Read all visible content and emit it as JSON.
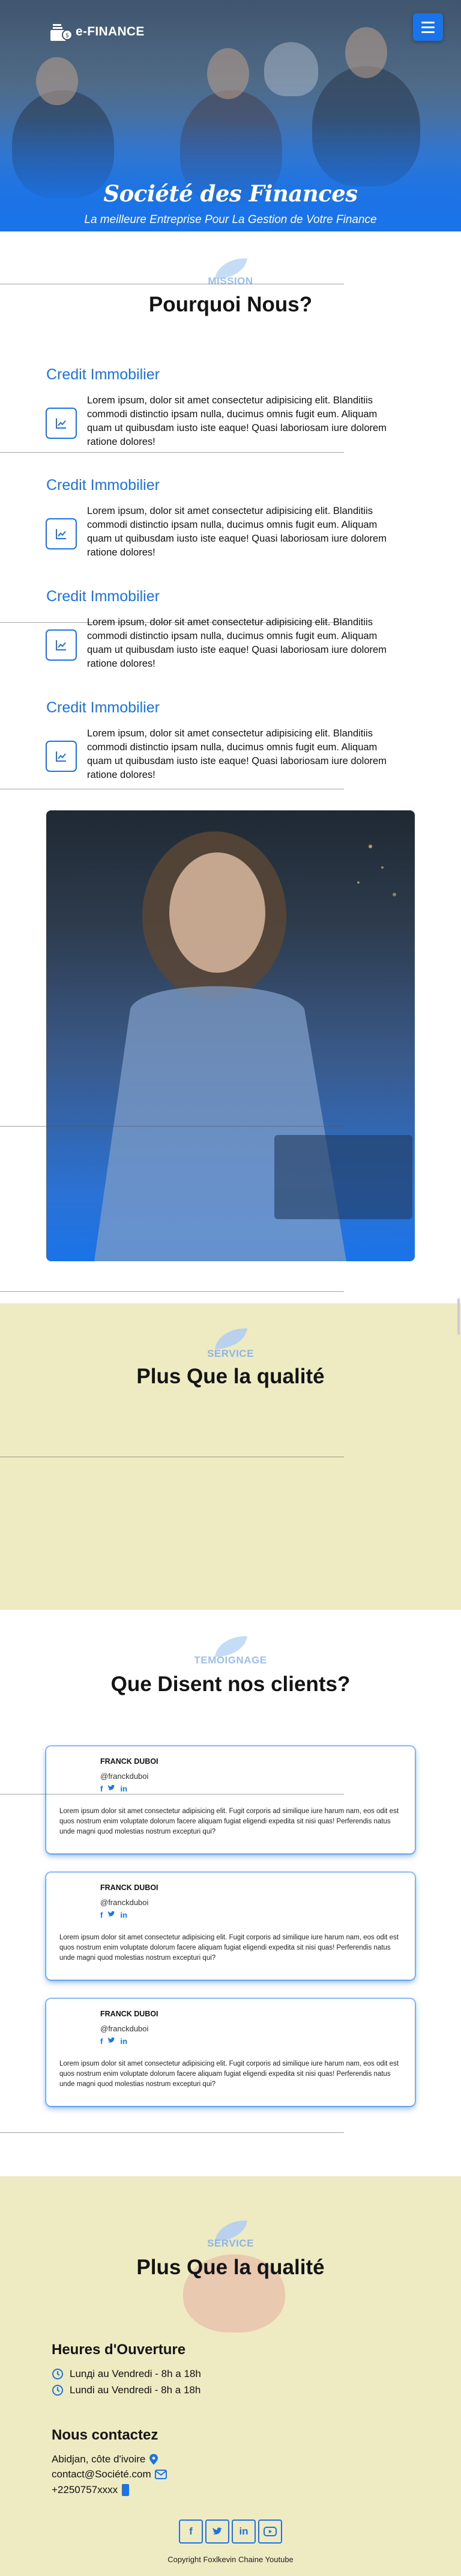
{
  "header": {
    "brand": "e-FINANCE",
    "title": "Société des Finances",
    "subtitle": "La meilleure Entreprise Pour La Gestion de Votre Finance",
    "menu_icon": "hamburger-menu-icon"
  },
  "mission": {
    "tag": "MISSION",
    "title": "Pourquoi Nous?",
    "items": [
      {
        "title": "Credit Immobilier",
        "text": "Lorem ipsum, dolor sit amet consectetur adipisicing elit. Blanditiis commodi distinctio ipsam nulla, ducimus omnis fugit eum. Aliquam quam ut quibusdam iusto iste eaque! Quasi laboriosam iure dolorem ratione dolores!",
        "icon": "chart-line-icon"
      },
      {
        "title": "Credit Immobilier",
        "text": "Lorem ipsum, dolor sit amet consectetur adipisicing elit. Blanditiis commodi distinctio ipsam nulla, ducimus omnis fugit eum. Aliquam quam ut quibusdam iusto iste eaque! Quasi laboriosam iure dolorem ratione dolores!",
        "icon": "chart-line-icon"
      },
      {
        "title": "Credit Immobilier",
        "text": "Lorem ipsum, dolor sit amet consectetur adipisicing elit. Blanditiis commodi distinctio ipsam nulla, ducimus omnis fugit eum. Aliquam quam ut quibusdam iusto iste eaque! Quasi laboriosam iure dolorem ratione dolores!",
        "icon": "chart-line-icon"
      },
      {
        "title": "Credit Immobilier",
        "text": "Lorem ipsum, dolor sit amet consectetur adipisicing elit. Blanditiis commodi distinctio ipsam nulla, ducimus omnis fugit eum. Aliquam quam ut quibusdam iusto iste eaque! Quasi laboriosam iure dolorem ratione dolores!",
        "icon": "chart-line-icon"
      }
    ]
  },
  "service": {
    "tag": "SERVICE",
    "title": "Plus Que la qualité"
  },
  "testimonials": {
    "tag": "TEMOIGNAGE",
    "title": "Que Disent nos clients?",
    "items": [
      {
        "name": "FRANCK DUBOI",
        "handle": "@franckduboi",
        "text": "Lorem ipsum dolor sit amet consectetur adipisicing elit. Fugit corporis ad similique iure harum nam, eos odit est quos nostrum enim voluptate dolorum facere aliquam fugiat eligendi expedita sit nisi quas! Perferendis natus unde magni quod molestias nostrum excepturi qui?"
      },
      {
        "name": "FRANCK DUBOI",
        "handle": "@franckduboi",
        "text": "Lorem ipsum dolor sit amet consectetur adipisicing elit. Fugit corporis ad similique iure harum nam, eos odit est quos nostrum enim voluptate dolorum facere aliquam fugiat eligendi expedita sit nisi quas! Perferendis natus unde magni quod molestias nostrum excepturi qui?"
      },
      {
        "name": "FRANCK DUBOI",
        "handle": "@franckduboi",
        "text": "Lorem ipsum dolor sit amet consectetur adipisicing elit. Fugit corporis ad similique iure harum nam, eos odit est quos nostrum enim voluptate dolorum facere aliquam fugiat eligendi expedita sit nisi quas! Perferendis natus unde magni quod molestias nostrum excepturi qui?"
      }
    ],
    "social_icons": [
      "facebook-icon",
      "twitter-icon",
      "linkedin-icon"
    ]
  },
  "footer": {
    "tag": "SERVICE",
    "title": "Plus Que la qualité",
    "hours_title": "Heures d'Ouverture",
    "hours": [
      "Lunді au Vendredi - 8h a 18h",
      "Lundi au Vendredi - 8h a 18h"
    ],
    "contact_title": "Nous contactez",
    "address": "Abidjan, côte d'ivoire",
    "email": "contact@Société.com",
    "phone": "+2250757xxxx",
    "socials": [
      "f",
      "t",
      "in",
      "▶"
    ],
    "copyright": "Copyright Foxlkevin Chaine Youtube"
  },
  "colors": {
    "accent": "#1a73e8",
    "cream": "#eeeac2"
  }
}
